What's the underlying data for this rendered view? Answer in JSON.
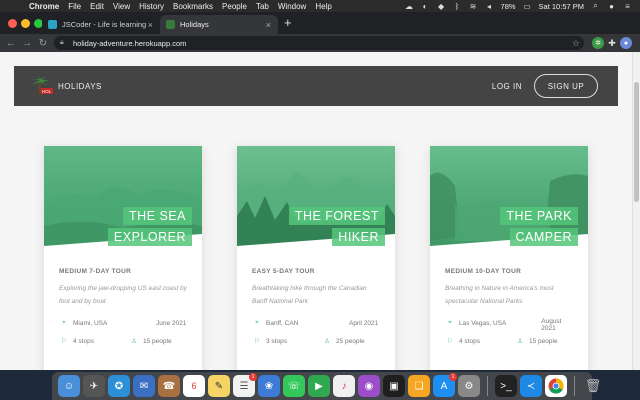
{
  "menubar": {
    "app_name": "Chrome",
    "items": [
      "File",
      "Edit",
      "View",
      "History",
      "Bookmarks",
      "People",
      "Tab",
      "Window",
      "Help"
    ],
    "battery": "78%",
    "clock": "Sat 10:57 PM"
  },
  "tabs": [
    {
      "title": "JSCoder - Life is learning",
      "active": false
    },
    {
      "title": "Holidays",
      "active": true
    }
  ],
  "address_bar": {
    "url": "holiday-adventure.herokuapp.com"
  },
  "site": {
    "logo_text": "HOLIDAYS",
    "nav_login": "LOG IN",
    "nav_signup": "SIGN UP"
  },
  "tours": [
    {
      "title_line1": "THE SEA",
      "title_line2": "EXPLORER",
      "subheading": "MEDIUM 7-DAY TOUR",
      "description": "Exploring the jaw-dropping US east coast by foot and by boat",
      "location": "Miami, USA",
      "date": "June 2021",
      "stops": "4 stops",
      "people": "15 people"
    },
    {
      "title_line1": "THE FOREST",
      "title_line2": "HIKER",
      "subheading": "EASY 5-DAY TOUR",
      "description": "Breathtaking hike through the Canadian Banff National Park",
      "location": "Banff, CAN",
      "date": "April 2021",
      "stops": "3 stops",
      "people": "25 people"
    },
    {
      "title_line1": "THE PARK",
      "title_line2": "CAMPER",
      "subheading": "MEDIUM 10-DAY TOUR",
      "description": "Breathing in Nature in America's most spectacular National Parks",
      "location": "Las Vegas, USA",
      "date": "August 2021",
      "stops": "4 stops",
      "people": "15 people"
    }
  ],
  "dock": {
    "calendar_day": "6",
    "reminders_badge": "1",
    "appstore_badge": "1"
  },
  "colors": {
    "accent": "#55c57a",
    "header_bg": "#444444",
    "page_bg": "#f5f5f5"
  }
}
